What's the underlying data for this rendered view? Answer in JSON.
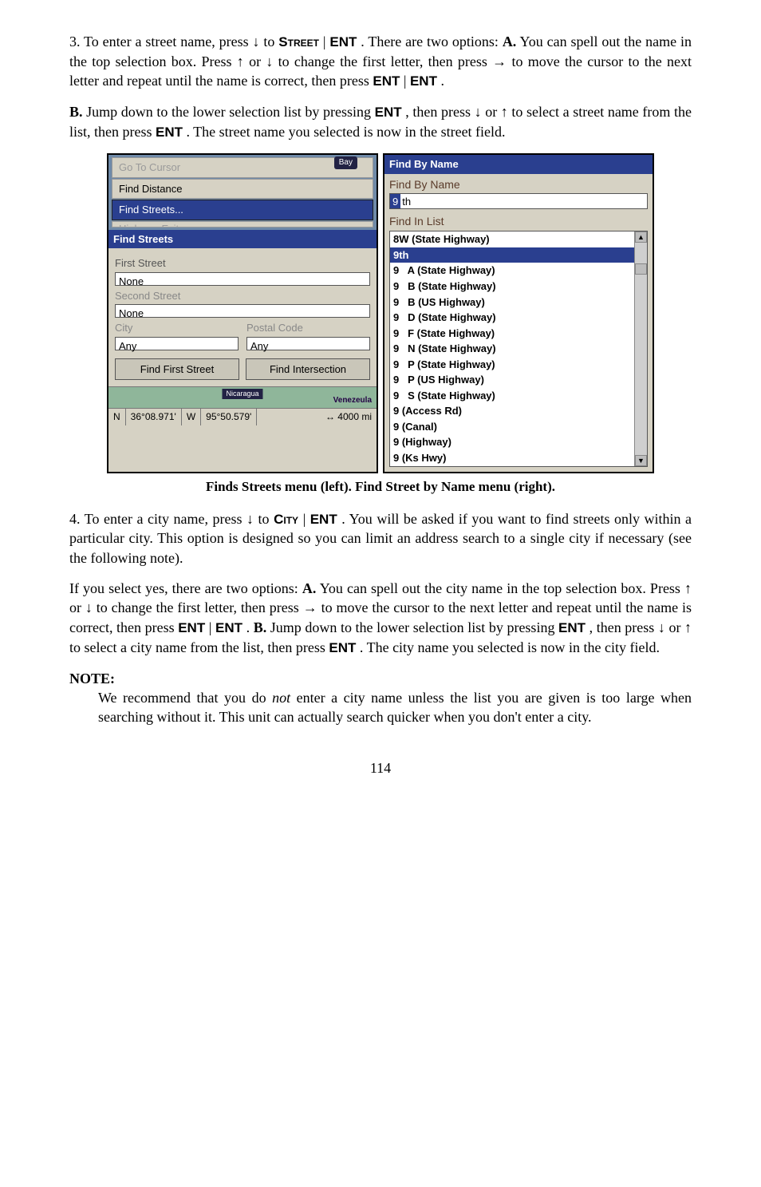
{
  "para1": {
    "t1": "3. To enter a street name, press ↓ to ",
    "street": "Street",
    "pipe1": "|",
    "ent1": "ENT",
    "t2": ". There are two options: ",
    "aLabel": "A.",
    "t3": " You can spell out the name in the top selection box. Press ↑ or ↓ to change the first letter, then press → to move the cursor to the next letter and repeat until the name is correct, then press ",
    "ent2": "ENT",
    "pipe2": "|",
    "ent3": "ENT",
    "t4": "."
  },
  "para2": {
    "bLabel": "B.",
    "t1": " Jump down to the lower selection list by pressing ",
    "ent1": "ENT",
    "t2": ", then press ↓ or ↑ to select a street name from the list, then press ",
    "ent2": "ENT",
    "t3": ". The street name you selected is now in the street field."
  },
  "leftPanel": {
    "menu": {
      "goToCursor": "Go To Cursor",
      "findDistance": "Find Distance",
      "findStreets": "Find Streets...",
      "highwayExits": "Highway Exits"
    },
    "bay": "Bay",
    "barTitle": "Find Streets",
    "firstStreetLabel": "First Street",
    "firstStreetValue": "None",
    "secondStreetLabel": "Second Street",
    "secondStreetValue": "None",
    "cityLabel": "City",
    "postalLabel": "Postal Code",
    "cityValue": "Any",
    "postalValue": "Any",
    "btnFirst": "Find First Street",
    "btnInter": "Find Intersection",
    "nic": "Nicaragua",
    "ven": "Venezeula",
    "status": {
      "n": "N",
      "lat": "36°08.971'",
      "w": "W",
      "lon": "95°50.579'",
      "scale": "↔ 4000 mi"
    }
  },
  "rightPanel": {
    "title": "Find By Name",
    "subtitle": "Find By Name",
    "topfieldSel": "9",
    "topfieldRest": "th",
    "listLabel": "Find In List",
    "rows": [
      "8W (State Highway)",
      "9th",
      "9   A (State Highway)",
      "9   B (State Highway)",
      "9   B (US Highway)",
      "9   D (State Highway)",
      "9   F (State Highway)",
      "9   N (State Highway)",
      "9   P (State Highway)",
      "9   P (US Highway)",
      "9   S (State Highway)",
      "9 (Access Rd)",
      "9 (Canal)",
      "9 (Highway)",
      "9 (Ks Hwy)"
    ],
    "selIndex": 1
  },
  "caption": "Finds Streets menu (left). Find Street by Name menu (right).",
  "para4": {
    "t1": "4. To enter a city name, press ↓ to ",
    "city": "City",
    "pipe": "|",
    "ent": "ENT",
    "t2": ". You will be asked if you want to find streets only within a particular city. This option is designed so you can limit an address search to a single city if necessary (see the following note)."
  },
  "para5": {
    "t1": "If you select yes, there are two options: ",
    "aLabel": "A.",
    "t2": " You can spell out the city name in the top selection box. Press ↑ or ↓ to change the first letter, then press → to move the cursor to the next letter and repeat until the name is correct, then press ",
    "ent1": "ENT",
    "pipe1": "|",
    "ent2": "ENT",
    "t3": ". ",
    "bLabel": "B.",
    "t4": " Jump down to the lower selection list by pressing ",
    "ent3": "ENT",
    "t5": ", then press ↓ or ↑ to select a city name from the list, then press ",
    "ent4": "ENT",
    "t6": ". The city name you selected is now in the city field."
  },
  "note": {
    "head": "NOTE:",
    "body1": "We recommend that you do ",
    "not": "not",
    "body2": " enter a city name unless the list you are given is too large when searching without it. This unit can actually search quicker when you don't enter a city."
  },
  "pageNum": "114"
}
